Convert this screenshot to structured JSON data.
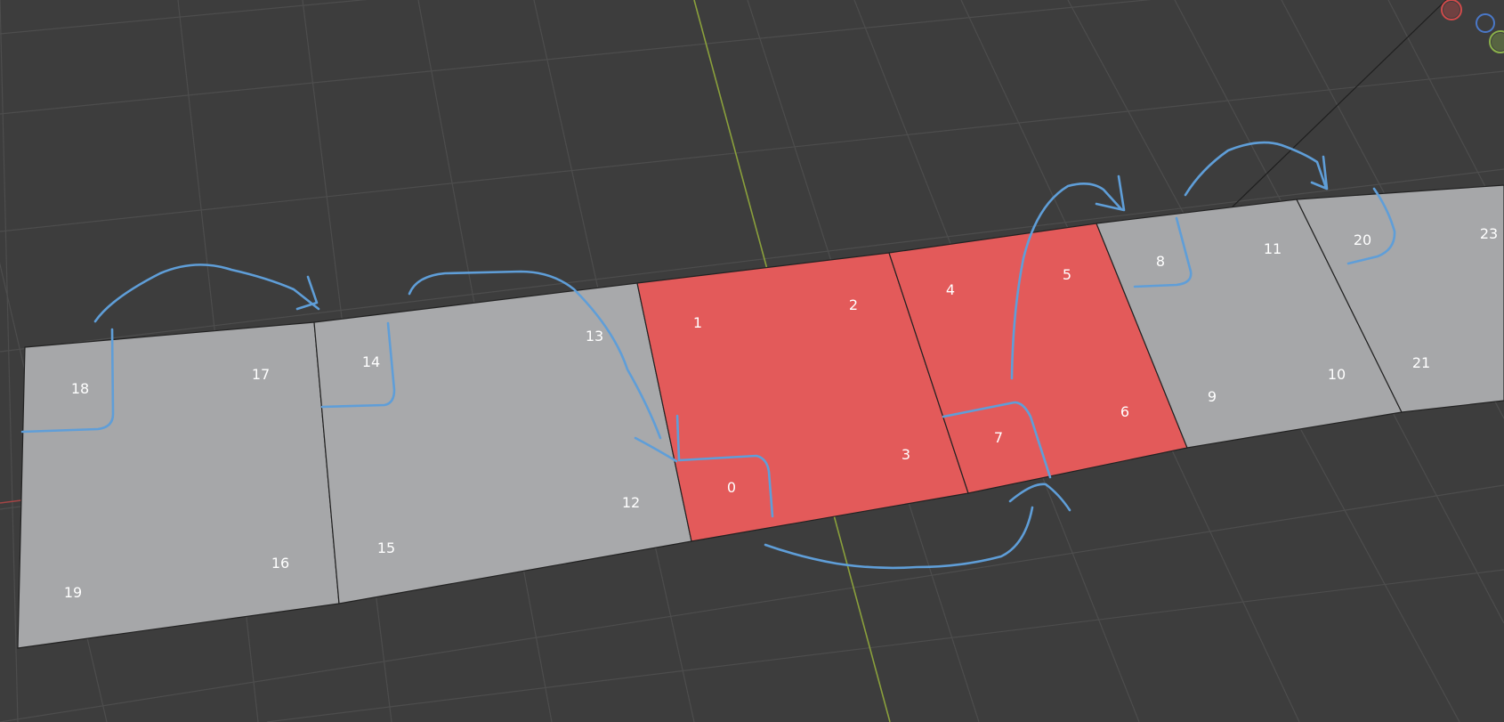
{
  "viewport": {
    "background": "#3d3d3d",
    "grid_color": "#4d4d4d",
    "face_unselected_color": "#a6a7a9",
    "face_selected_color": "#e35a5a",
    "edge_color": "#222222",
    "y_axis_color": "#8aa03c",
    "x_axis_color": "#a34545",
    "annotation_color": "#5f9ed8"
  },
  "faces": [
    {
      "id": "face-a",
      "selected": false
    },
    {
      "id": "face-b",
      "selected": false
    },
    {
      "id": "face-c",
      "selected": true
    },
    {
      "id": "face-d",
      "selected": true
    },
    {
      "id": "face-e",
      "selected": false
    },
    {
      "id": "face-f",
      "selected": false
    }
  ],
  "vertex_labels": [
    "0",
    "1",
    "2",
    "3",
    "4",
    "5",
    "6",
    "7",
    "8",
    "9",
    "10",
    "11",
    "12",
    "13",
    "14",
    "15",
    "16",
    "17",
    "18",
    "19",
    "20",
    "21",
    "23"
  ],
  "annotations": {
    "description": "hand-drawn blue arrows showing vertex ordering"
  },
  "navigation_gizmo": {
    "x_color": "#d04a4a",
    "y_color": "#8ab04a",
    "z_color": "#4a78c8"
  }
}
